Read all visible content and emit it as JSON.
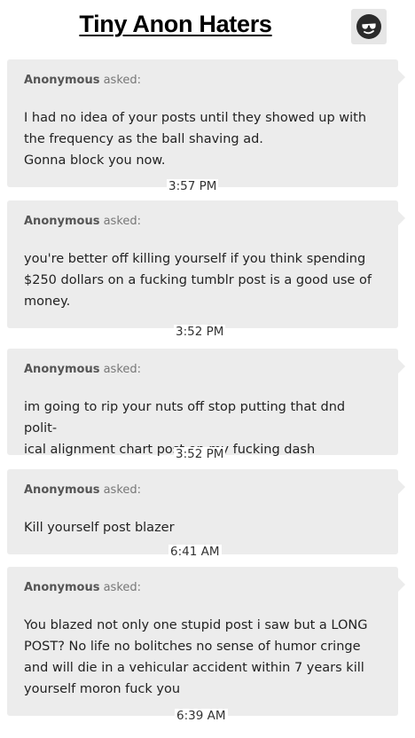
{
  "header": {
    "title": "Tiny Anon Haters",
    "avatar_icon": "sunglasses-face-icon"
  },
  "messages": [
    {
      "asker": "Anonymous",
      "verb": "asked:",
      "lines": [
        "I had no idea of your posts until they showed up with",
        "the frequency as the ball shaving ad.",
        "Gonna block you now."
      ],
      "time": "3:57 PM"
    },
    {
      "asker": "Anonymous",
      "verb": "asked:",
      "lines": [
        "you're better off killing yourself if you think spending",
        "$250 dollars on a fucking tumblr post is a good use of",
        "money."
      ],
      "time": "3:52 PM"
    },
    {
      "asker": "Anonymous",
      "verb": "asked:",
      "lines": [
        "im going to rip your nuts off stop putting that dnd polit-",
        "ical alignment chart post on my fucking dash"
      ],
      "time": "3:52 PM"
    },
    {
      "asker": "Anonymous",
      "verb": "asked:",
      "lines": [
        "Kill yourself post blazer"
      ],
      "time": "6:41 AM"
    },
    {
      "asker": "Anonymous",
      "verb": "asked:",
      "lines": [
        "You blazed not only one stupid post i saw but a LONG",
        "POST? No life no bolitches no sense of humor cringe",
        "and will die in a vehicular accident within 7 years kill",
        "yourself moron fuck you"
      ],
      "time": "6:39 AM"
    }
  ]
}
